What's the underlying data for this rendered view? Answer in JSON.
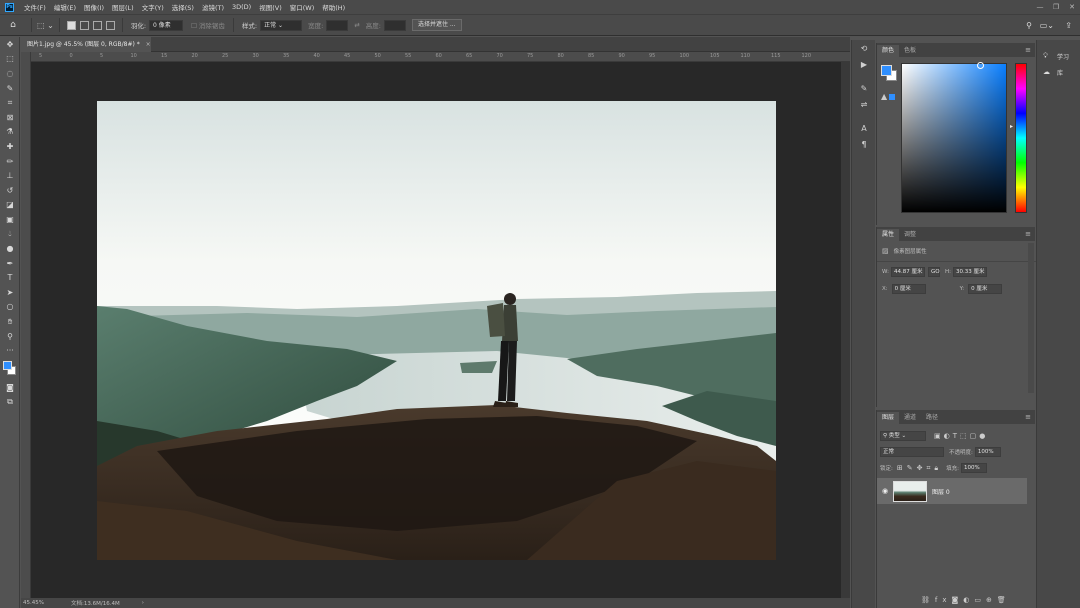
{
  "menu": {
    "items": [
      "文件(F)",
      "编辑(E)",
      "图像(I)",
      "图层(L)",
      "文字(Y)",
      "选择(S)",
      "滤镜(T)",
      "3D(D)",
      "视图(V)",
      "窗口(W)",
      "帮助(H)"
    ]
  },
  "options": {
    "feather_label": "羽化:",
    "feather_value": "0 像素",
    "antialias": "消除锯齿",
    "style_label": "样式:",
    "style_value": "正常",
    "width_label": "宽度:",
    "height_label": "高度:",
    "select_mask": "选择并遮住 ..."
  },
  "document": {
    "tab_title": "图片1.jpg @ 45.5% (图层 0, RGB/8#) *",
    "ruler_marks": [
      "5",
      "0",
      "5",
      "10",
      "15",
      "20",
      "25",
      "30",
      "35",
      "40",
      "45",
      "50",
      "55",
      "60",
      "65",
      "70",
      "75",
      "80",
      "85",
      "90",
      "95",
      "100",
      "105",
      "110",
      "115",
      "120"
    ]
  },
  "status": {
    "zoom": "45.45%",
    "doc_info": "文档:13.6M/16.4M"
  },
  "color_panel": {
    "tabs": [
      "颜色",
      "色板"
    ],
    "fg": "#2f8fff",
    "bg": "#ffffff"
  },
  "properties_panel": {
    "tabs": [
      "属性",
      "调整"
    ],
    "subtitle": "像素图层属性",
    "w_label": "W:",
    "w_value": "44.87 厘米",
    "go_label": "GO",
    "h_label": "H:",
    "h_value": "30.33 厘米",
    "x_label": "X:",
    "x_value": "0 厘米",
    "y_label": "Y:",
    "y_value": "0 厘米"
  },
  "layers_panel": {
    "tabs": [
      "图层",
      "通道",
      "路径"
    ],
    "filter": "类型",
    "blend_mode": "正常",
    "opacity_label": "不透明度:",
    "opacity_value": "100%",
    "lock_label": "锁定:",
    "fill_label": "填充:",
    "fill_value": "100%",
    "layer_name": "图层 0"
  },
  "learn_panel": {
    "items": [
      "学习",
      "库"
    ]
  }
}
